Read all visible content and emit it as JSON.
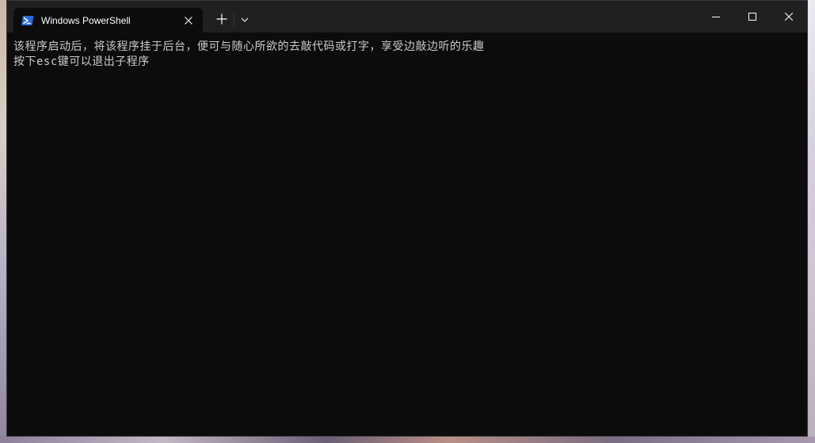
{
  "window": {
    "tab_title": "Windows PowerShell",
    "tab_icon": "powershell-icon"
  },
  "titlebar": {
    "new_tab_icon": "plus-icon",
    "dropdown_icon": "chevron-down-icon",
    "minimize_icon": "minimize-icon",
    "maximize_icon": "maximize-icon",
    "close_icon": "close-icon"
  },
  "console": {
    "lines": [
      "该程序启动后，将该程序挂于后台，便可与随心所欲的去敲代码或打字，享受边敲边听的乐趣",
      "按下esc键可以退出子程序"
    ]
  },
  "colors": {
    "titlebar_bg": "#202020",
    "console_bg": "#0c0c0c",
    "console_text": "#cccccc",
    "icon_accent": "#2b6cd6"
  }
}
